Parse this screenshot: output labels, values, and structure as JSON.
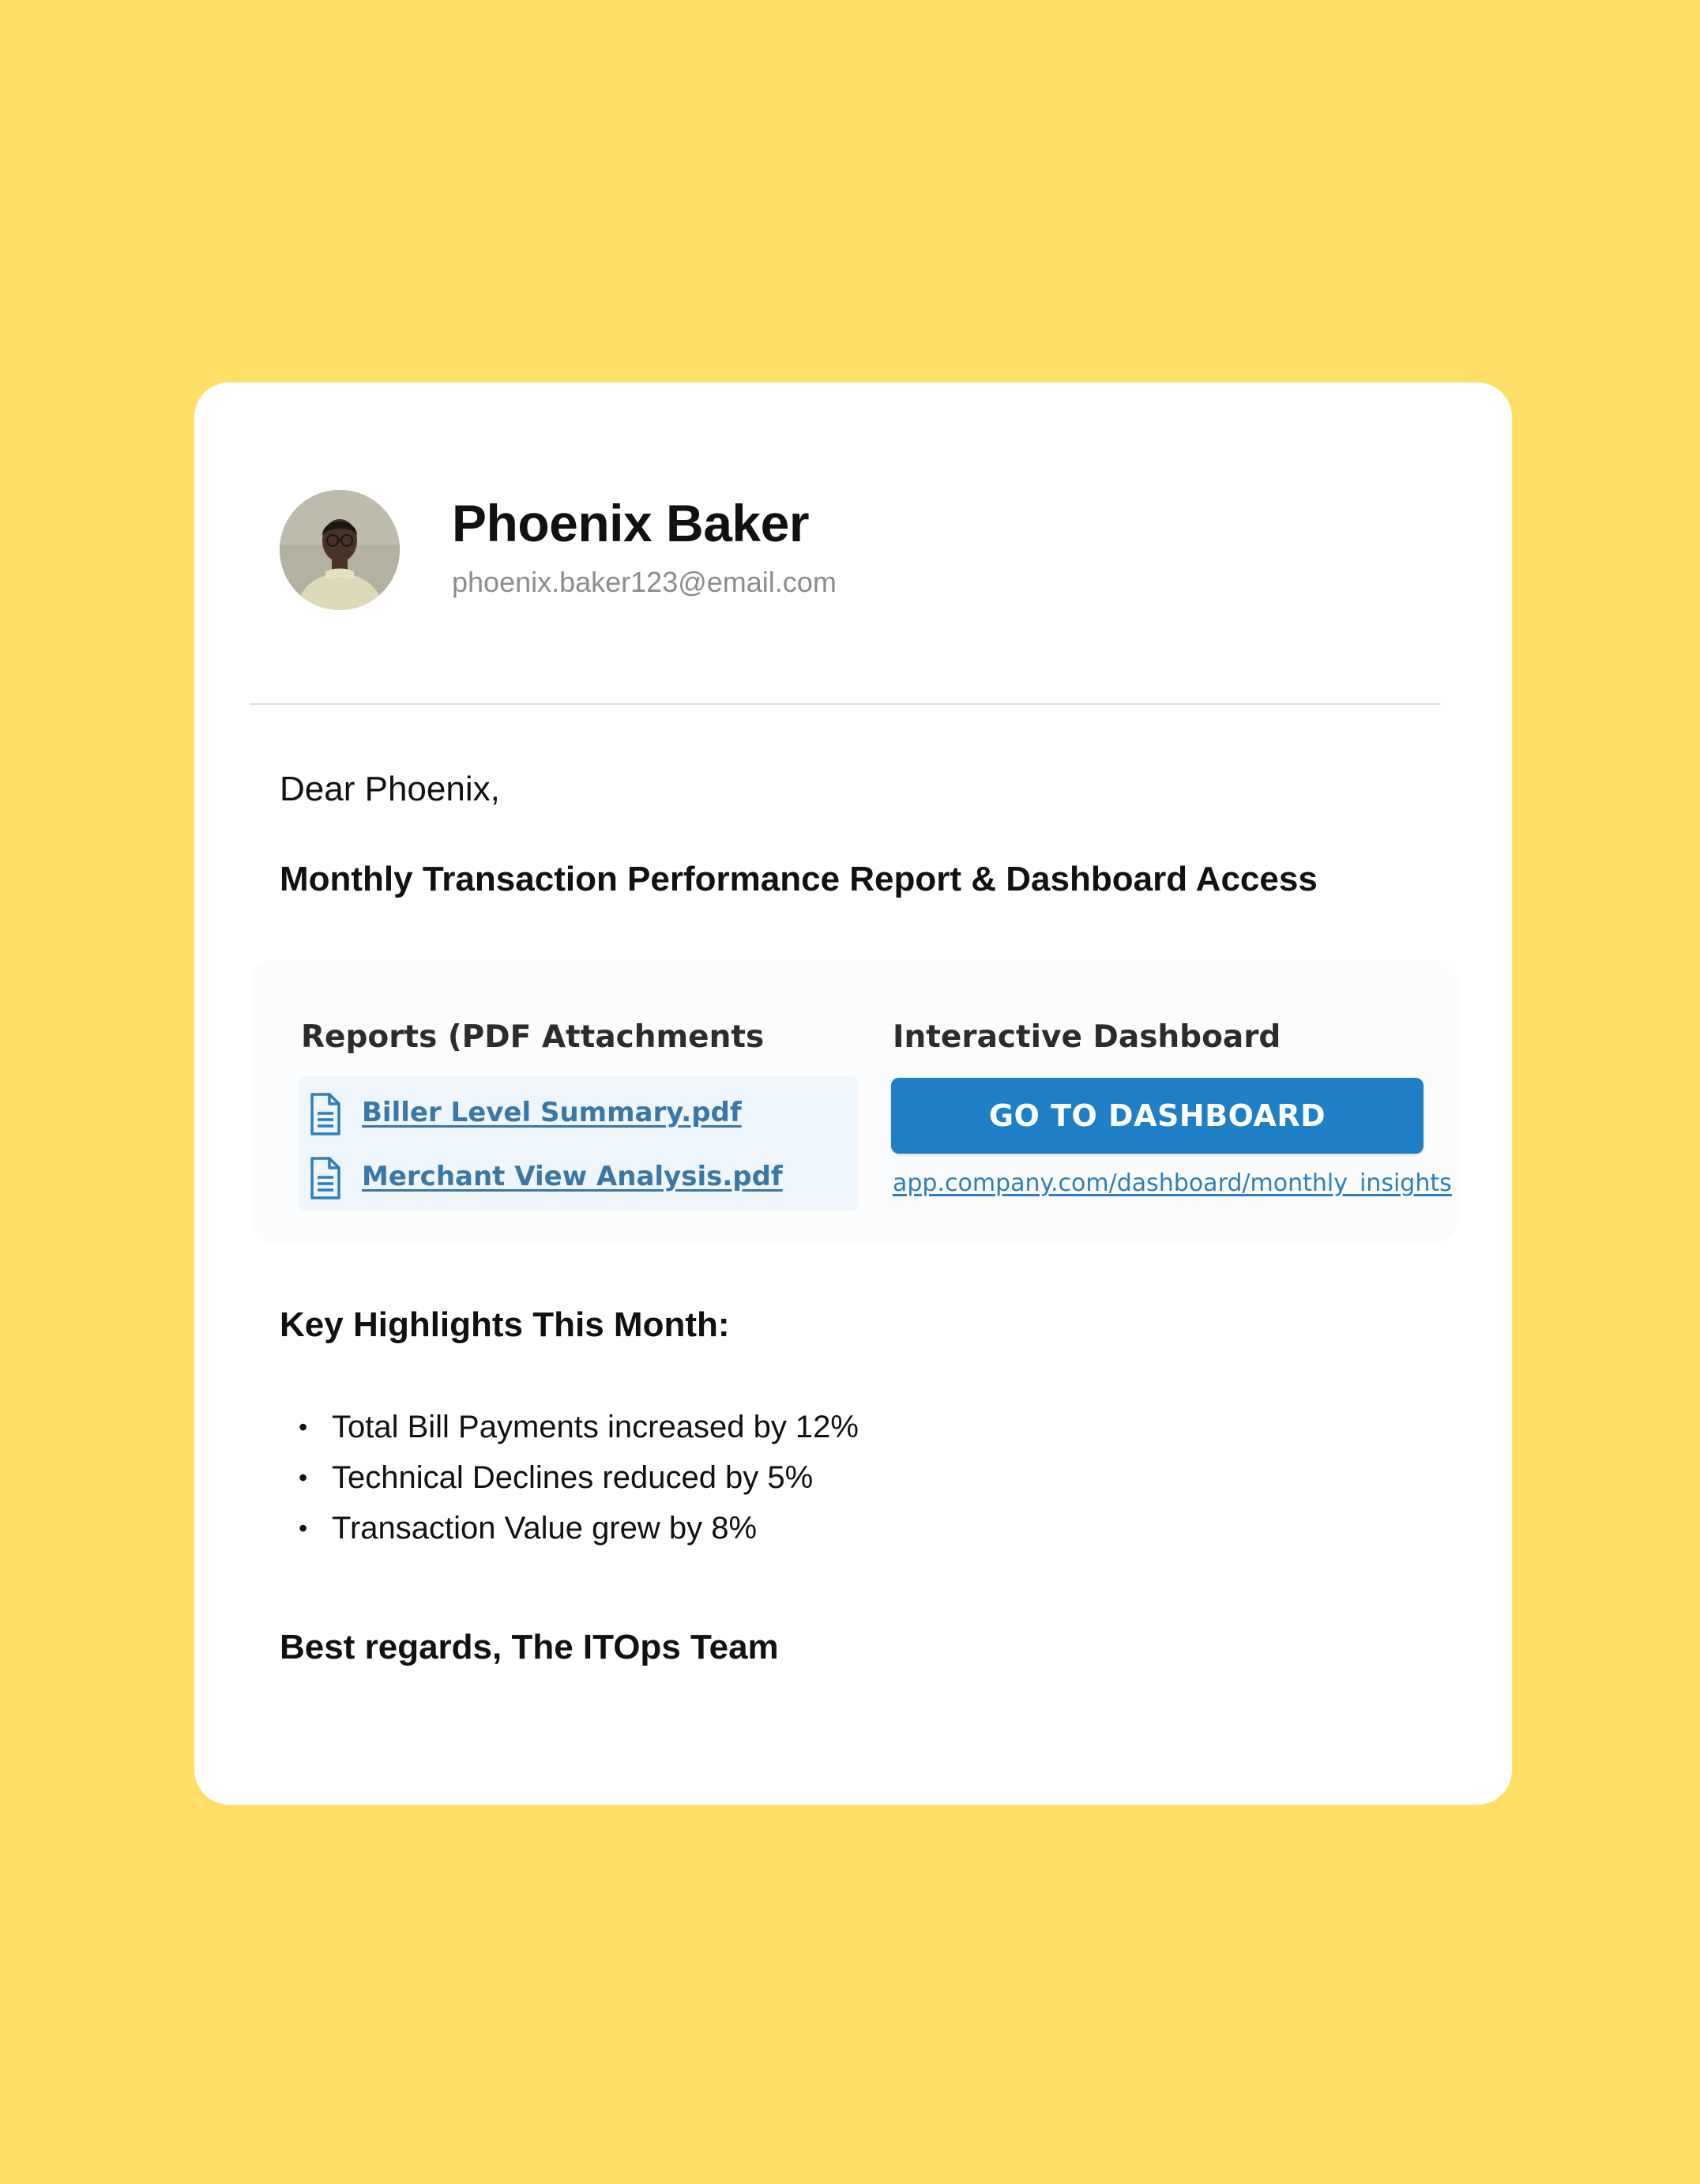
{
  "sender": {
    "name": "Phoenix Baker",
    "email": "phoenix.baker123@email.com"
  },
  "message": {
    "greeting": "Dear Phoenix,",
    "subject": "Monthly Transaction Performance Report & Dashboard Access"
  },
  "reports": {
    "title": "Reports (PDF Attachments",
    "attachments": [
      {
        "label": "Biller Level Summary.pdf ",
        "icon": "document-icon"
      },
      {
        "label": "Merchant View Analysis.pdf",
        "icon": "document-icon"
      }
    ]
  },
  "dashboard": {
    "title": "Interactive Dashboard",
    "button_label": "GO TO DASHBOARD",
    "link": "app.company.com/dashboard/monthly_insights"
  },
  "highlights": {
    "title": "Key Highlights This Month:",
    "items": [
      "Total Bill Payments increased by 12%",
      "Technical Declines reduced by 5%",
      "Transaction Value grew by 8%"
    ]
  },
  "signoff": "Best regards, The ITOps Team",
  "colors": {
    "background": "#FFDF66",
    "card": "#FFFFFF",
    "button": "#1F7FC6",
    "link": "#3B77A6"
  }
}
